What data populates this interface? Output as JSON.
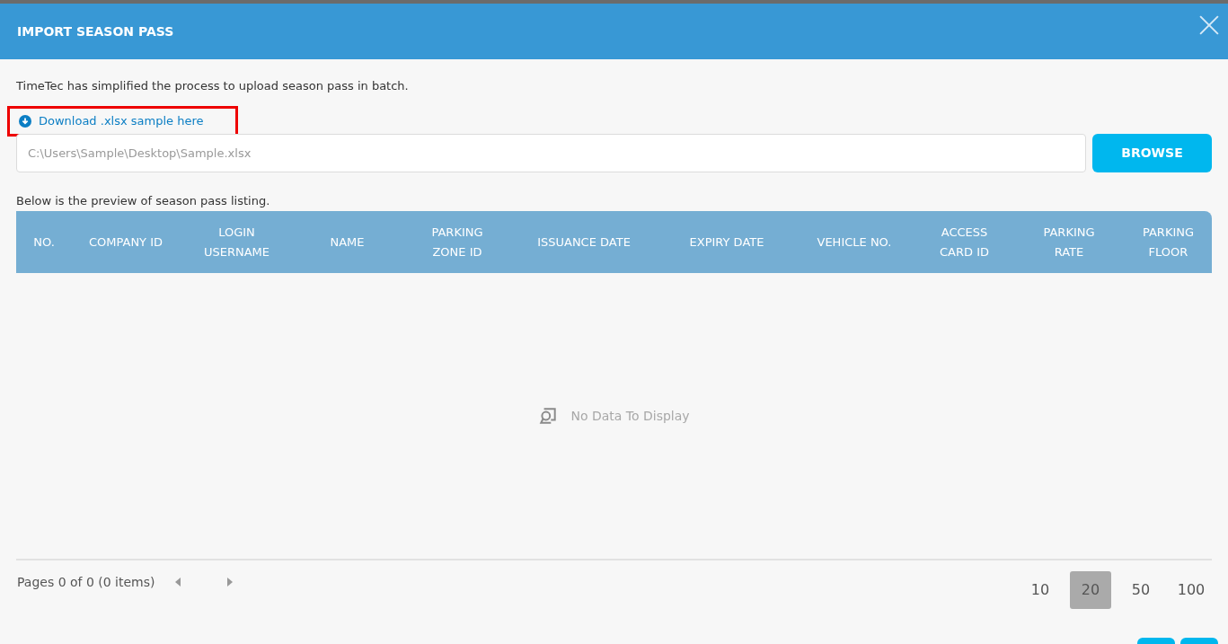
{
  "dialog": {
    "title": "IMPORT SEASON PASS"
  },
  "intro": "TimeTec has simplified the process to upload season pass in batch.",
  "download_link": {
    "label": "Download .xlsx sample here",
    "highlighted": true
  },
  "file_field": {
    "placeholder": "C:\\Users\\Sample\\Desktop\\Sample.xlsx"
  },
  "browse_button": "BROWSE",
  "preview_caption": "Below is the preview of season pass listing.",
  "table": {
    "columns": [
      {
        "lines": [
          "NO."
        ]
      },
      {
        "lines": [
          "COMPANY ID"
        ]
      },
      {
        "lines": [
          "LOGIN",
          "USERNAME"
        ]
      },
      {
        "lines": [
          "NAME"
        ]
      },
      {
        "lines": [
          "PARKING",
          "ZONE ID"
        ]
      },
      {
        "lines": [
          "ISSUANCE DATE"
        ]
      },
      {
        "lines": [
          "EXPIRY DATE"
        ]
      },
      {
        "lines": [
          "VEHICLE NO."
        ]
      },
      {
        "lines": [
          "ACCESS",
          "CARD ID"
        ]
      },
      {
        "lines": [
          "PARKING",
          "RATE"
        ]
      },
      {
        "lines": [
          "PARKING",
          "FLOOR"
        ]
      }
    ],
    "empty_message": "No Data To Display"
  },
  "pager": {
    "summary": "Pages 0 of 0 (0 items)",
    "page_sizes": [
      {
        "label": "10",
        "selected": false
      },
      {
        "label": "20",
        "selected": true
      },
      {
        "label": "50",
        "selected": false
      },
      {
        "label": "100",
        "selected": false
      }
    ]
  }
}
